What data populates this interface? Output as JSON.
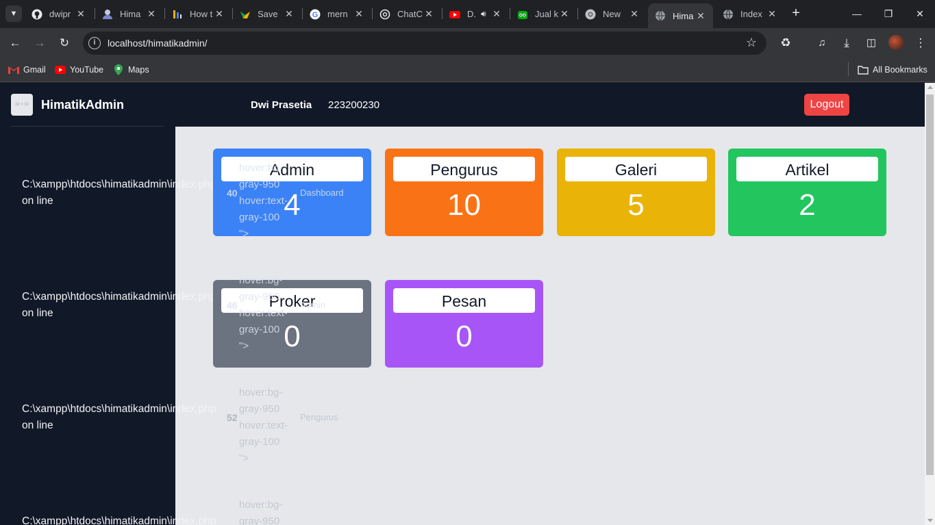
{
  "browser": {
    "tabs": [
      {
        "title": "dwipr",
        "icon": "github-icon"
      },
      {
        "title": "Hima",
        "icon": "profile-icon"
      },
      {
        "title": "How t",
        "icon": "bars-icon"
      },
      {
        "title": "Save",
        "icon": "star-logo-icon"
      },
      {
        "title": "mern",
        "icon": "google-icon"
      },
      {
        "title": "ChatC",
        "icon": "chatgpt-icon"
      },
      {
        "title": "D.",
        "icon": "youtube-icon"
      },
      {
        "title": "Jual k",
        "icon": "tokopedia-icon"
      },
      {
        "title": "New",
        "icon": "chrome-icon"
      },
      {
        "title": "Hima",
        "icon": "globe-icon",
        "active": true
      },
      {
        "title": "Index",
        "icon": "globe-icon"
      }
    ],
    "url": "localhost/himatikadmin/",
    "bookmarks": [
      {
        "label": "Gmail",
        "icon": "gmail-icon"
      },
      {
        "label": "YouTube",
        "icon": "youtube-icon"
      },
      {
        "label": "Maps",
        "icon": "maps-icon"
      }
    ],
    "all_bookmarks": "All Bookmarks"
  },
  "header": {
    "logo_placeholder": "32 × 32",
    "brand": "HimatikAdmin",
    "user_name": "Dwi Prasetia",
    "user_id": "223200230",
    "logout": "Logout"
  },
  "sidebar": {
    "error_path": "C:\\xampp\\htdocs\\himatikadmin\\index.php",
    "error_suffix": "on line",
    "garble": [
      "hover:bg-",
      "gray-950",
      "hover:text-",
      "gray-100",
      "\">"
    ],
    "items": [
      {
        "line": "40",
        "label": "Dashboard"
      },
      {
        "line": "46",
        "label": "Admin"
      },
      {
        "line": "52",
        "label": "Pengurus"
      },
      {
        "line": "",
        "label": ""
      }
    ]
  },
  "cards": [
    {
      "label": "Admin",
      "count": "4",
      "color": "#3b82f6"
    },
    {
      "label": "Pengurus",
      "count": "10",
      "color": "#f97316"
    },
    {
      "label": "Galeri",
      "count": "5",
      "color": "#eab308"
    },
    {
      "label": "Artikel",
      "count": "2",
      "color": "#22c55e"
    },
    {
      "label": "Proker",
      "count": "0",
      "color": "#6b7280"
    },
    {
      "label": "Pesan",
      "count": "0",
      "color": "#a855f7"
    }
  ]
}
